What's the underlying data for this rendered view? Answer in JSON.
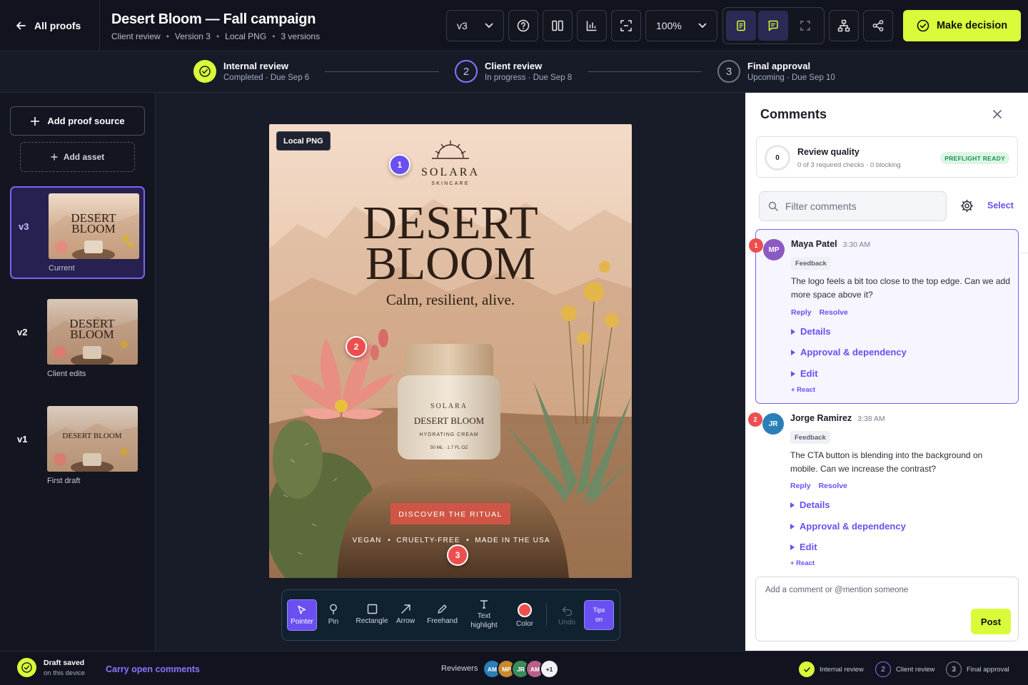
{
  "header": {
    "back_label": "All proofs",
    "title": "Desert Bloom — Fall campaign",
    "meta": [
      "Client review",
      "Version 3",
      "Local PNG",
      "3 versions"
    ],
    "version_select": "v3",
    "zoom": "100%",
    "decision_label": "Make decision",
    "accent": "#d8fb3a"
  },
  "stepper": [
    {
      "title": "Internal review",
      "sub": "Completed · Due Sep 6",
      "state": "done"
    },
    {
      "title": "Client review",
      "sub": "In progress · Due Sep 8",
      "state": "active",
      "num": "2"
    },
    {
      "title": "Final approval",
      "sub": "Upcoming · Due Sep 10",
      "state": "upcoming",
      "num": "3"
    }
  ],
  "sidebar": {
    "add_source": "Add proof source",
    "add_asset": "Add asset",
    "versions": [
      {
        "label": "v3",
        "caption": "Current"
      },
      {
        "label": "v2",
        "caption": "Client edits"
      },
      {
        "label": "v1",
        "caption": "First draft"
      }
    ]
  },
  "poster": {
    "tag": "Local PNG",
    "brand": "SOLARA",
    "brand_sub": "SKINCARE",
    "headline1": "DESERT",
    "headline2": "BLOOM",
    "tagline": "Calm, resilient, alive.",
    "jar_brand": "SOLARA",
    "jar_name": "DESERT BLOOM",
    "jar_type": "HYDRATING CREAM",
    "jar_size": "50 ML  ·  1.7 FL OZ",
    "cta": "DISCOVER THE RITUAL",
    "claims": [
      "VEGAN",
      "CRUELTY-FREE",
      "MADE IN THE USA"
    ],
    "pins": [
      "1",
      "2",
      "3"
    ]
  },
  "tools": {
    "items": [
      "Pointer",
      "Pin",
      "Rectangle",
      "Arrow",
      "Freehand",
      "Text highlight",
      "Color",
      "Undo"
    ],
    "tips": [
      "Tips",
      "on"
    ],
    "color": "#ee4e4e"
  },
  "comments": {
    "title": "Comments",
    "quality": {
      "score": "0",
      "title": "Review quality",
      "sub": "0 of 3 required checks · 0 blocking",
      "badge": "PREFLIGHT READY"
    },
    "filter_placeholder": "Filter comments",
    "select_label": "Select",
    "items": [
      {
        "num": "1",
        "initials": "MP",
        "name": "Maya Patel",
        "time": "3:30 AM",
        "tag": "Feedback",
        "body": "The logo feels a bit too close to the top edge. Can we add more space above it?",
        "reply": "Reply",
        "resolve": "Resolve",
        "sections": [
          "Details",
          "Approval & dependency",
          "Edit"
        ],
        "react": "+ React"
      },
      {
        "num": "2",
        "initials": "JR",
        "name": "Jorge Ramirez",
        "time": "3:38 AM",
        "tag": "Feedback",
        "body": "The CTA button is blending into the background on mobile. Can we increase the contrast?",
        "reply": "Reply",
        "resolve": "Resolve",
        "sections": [
          "Details",
          "Approval & dependency",
          "Edit"
        ],
        "react": "+ React"
      }
    ],
    "compose_placeholder": "Add a comment or @mention someone",
    "post_label": "Post"
  },
  "footer": {
    "draft_title": "Draft saved",
    "draft_sub": "on this device",
    "carry": "Carry open comments",
    "reviewers_label": "Reviewers",
    "reviewers": [
      "AM",
      "MP",
      "JR",
      "AM",
      "+1"
    ],
    "steps": [
      {
        "label": "Internal review"
      },
      {
        "num": "2",
        "label": "Client review"
      },
      {
        "num": "3",
        "label": "Final approval"
      }
    ]
  }
}
